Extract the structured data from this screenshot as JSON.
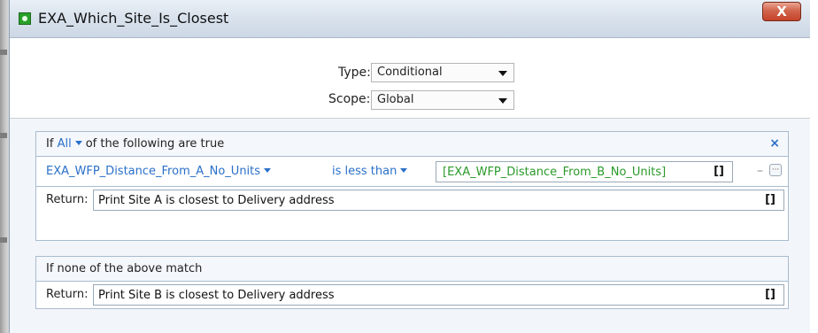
{
  "window": {
    "title": "EXA_Which_Site_Is_Closest",
    "close_label": "X"
  },
  "form": {
    "type_label": "Type:",
    "type_value": "Conditional",
    "scope_label": "Scope:",
    "scope_value": "Global"
  },
  "condition_block": {
    "if_label": "If",
    "quantifier": "All",
    "following_text": "of the following are true",
    "remove_label": "×",
    "field": "EXA_WFP_Distance_From_A_No_Units",
    "operator": "is less than",
    "value": "[EXA_WFP_Distance_From_B_No_Units]",
    "value_bracket": "[]",
    "minus_label": "–",
    "more_label": "···",
    "return_label": "Return:",
    "return_value": "Print Site A is closest to Delivery address",
    "return_bracket": "[]"
  },
  "fallback_block": {
    "header": "If none of the above match",
    "return_label": "Return:",
    "return_value": "Print Site B is closest to Delivery address",
    "return_bracket": "[]"
  },
  "colors": {
    "link_blue": "#2a6fc9",
    "value_green": "#2a9a2a",
    "close_red": "#c4432a",
    "panel_border": "#a9bccf"
  },
  "icons": {
    "app": "gear-icon",
    "close": "close-icon",
    "dropdown": "chevron-down-icon"
  }
}
